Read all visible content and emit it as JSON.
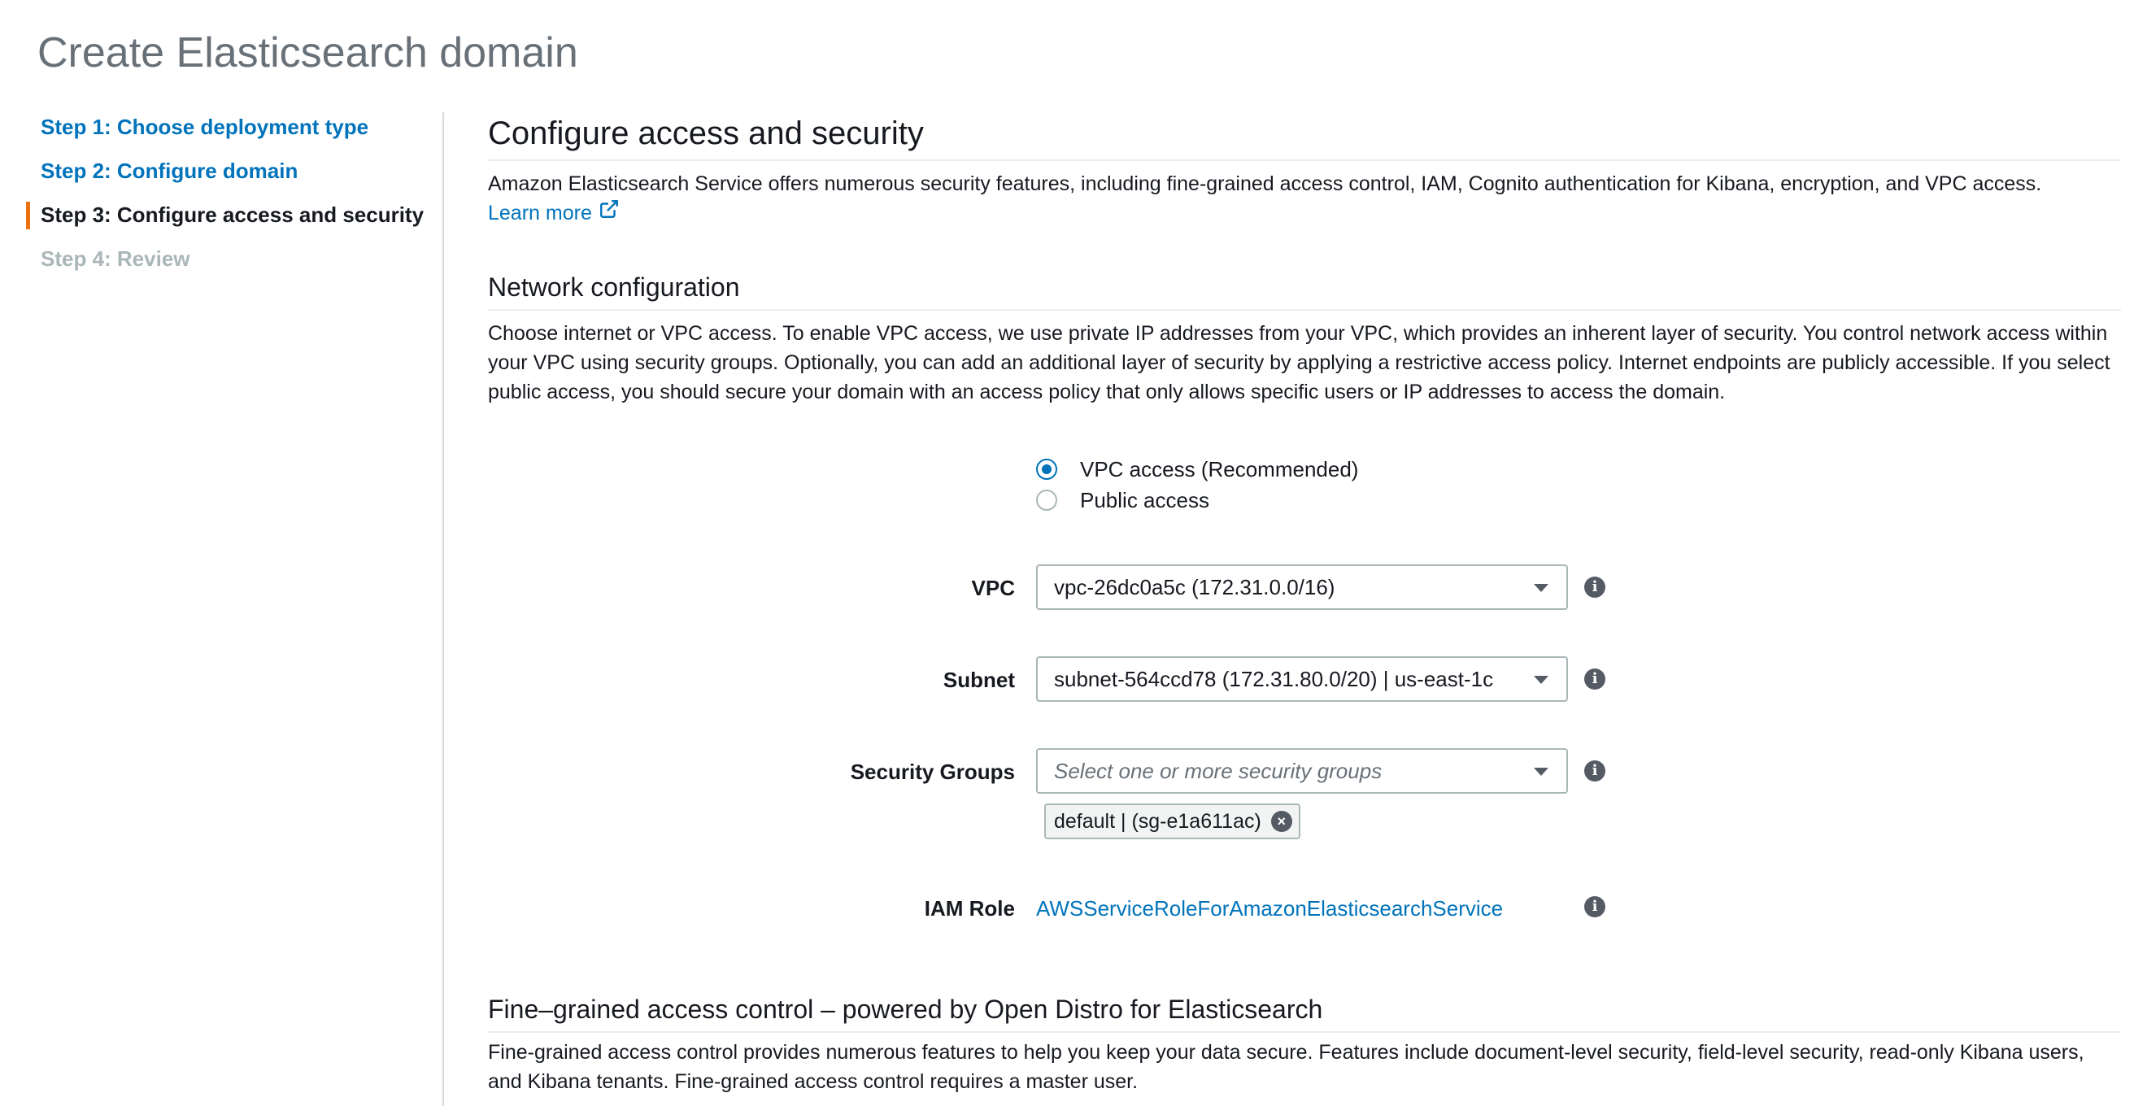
{
  "page": {
    "title": "Create Elasticsearch domain"
  },
  "sidebar": {
    "steps": [
      {
        "label": "Step 1: Choose deployment type",
        "state": "link"
      },
      {
        "label": "Step 2: Configure domain",
        "state": "link"
      },
      {
        "label": "Step 3: Configure access and security",
        "state": "current"
      },
      {
        "label": "Step 4: Review",
        "state": "disabled"
      }
    ]
  },
  "main": {
    "title": "Configure access and security",
    "description": "Amazon Elasticsearch Service offers numerous security features, including fine-grained access control, IAM, Cognito authentication for Kibana, encryption, and VPC access.",
    "learn_more": "Learn more",
    "network": {
      "title": "Network configuration",
      "description": "Choose internet or VPC access. To enable VPC access, we use private IP addresses from your VPC, which provides an inherent layer of security. You control network access within your VPC using security groups. Optionally, you can add an additional layer of security by applying a restrictive access policy. Internet endpoints are publicly accessible. If you select public access, you should secure your domain with an access policy that only allows specific users or IP addresses to access the domain.",
      "access_options": [
        {
          "label": "VPC access (Recommended)",
          "checked": true
        },
        {
          "label": "Public access",
          "checked": false
        }
      ],
      "vpc": {
        "label": "VPC",
        "value": "vpc-26dc0a5c (172.31.0.0/16)"
      },
      "subnet": {
        "label": "Subnet",
        "value": "subnet-564ccd78 (172.31.80.0/20) | us-east-1c"
      },
      "security_groups": {
        "label": "Security Groups",
        "placeholder": "Select one or more security groups",
        "selected": [
          "default | (sg-e1a611ac)"
        ]
      },
      "iam_role": {
        "label": "IAM Role",
        "value": "AWSServiceRoleForAmazonElasticsearchService"
      }
    },
    "fgac": {
      "title": "Fine–grained access control – powered by Open Distro for Elasticsearch",
      "description": "Fine-grained access control provides numerous features to help you keep your data secure. Features include document-level security, field-level security, read-only Kibana users, and Kibana tenants. Fine-grained access control requires a master user."
    }
  },
  "colors": {
    "link": "#0073bb",
    "current_step_marker": "#ec7211",
    "radio_checked": "#0073bb"
  },
  "icons": [
    "external-link-icon",
    "info-icon",
    "caret-down-icon",
    "remove-token-icon"
  ]
}
